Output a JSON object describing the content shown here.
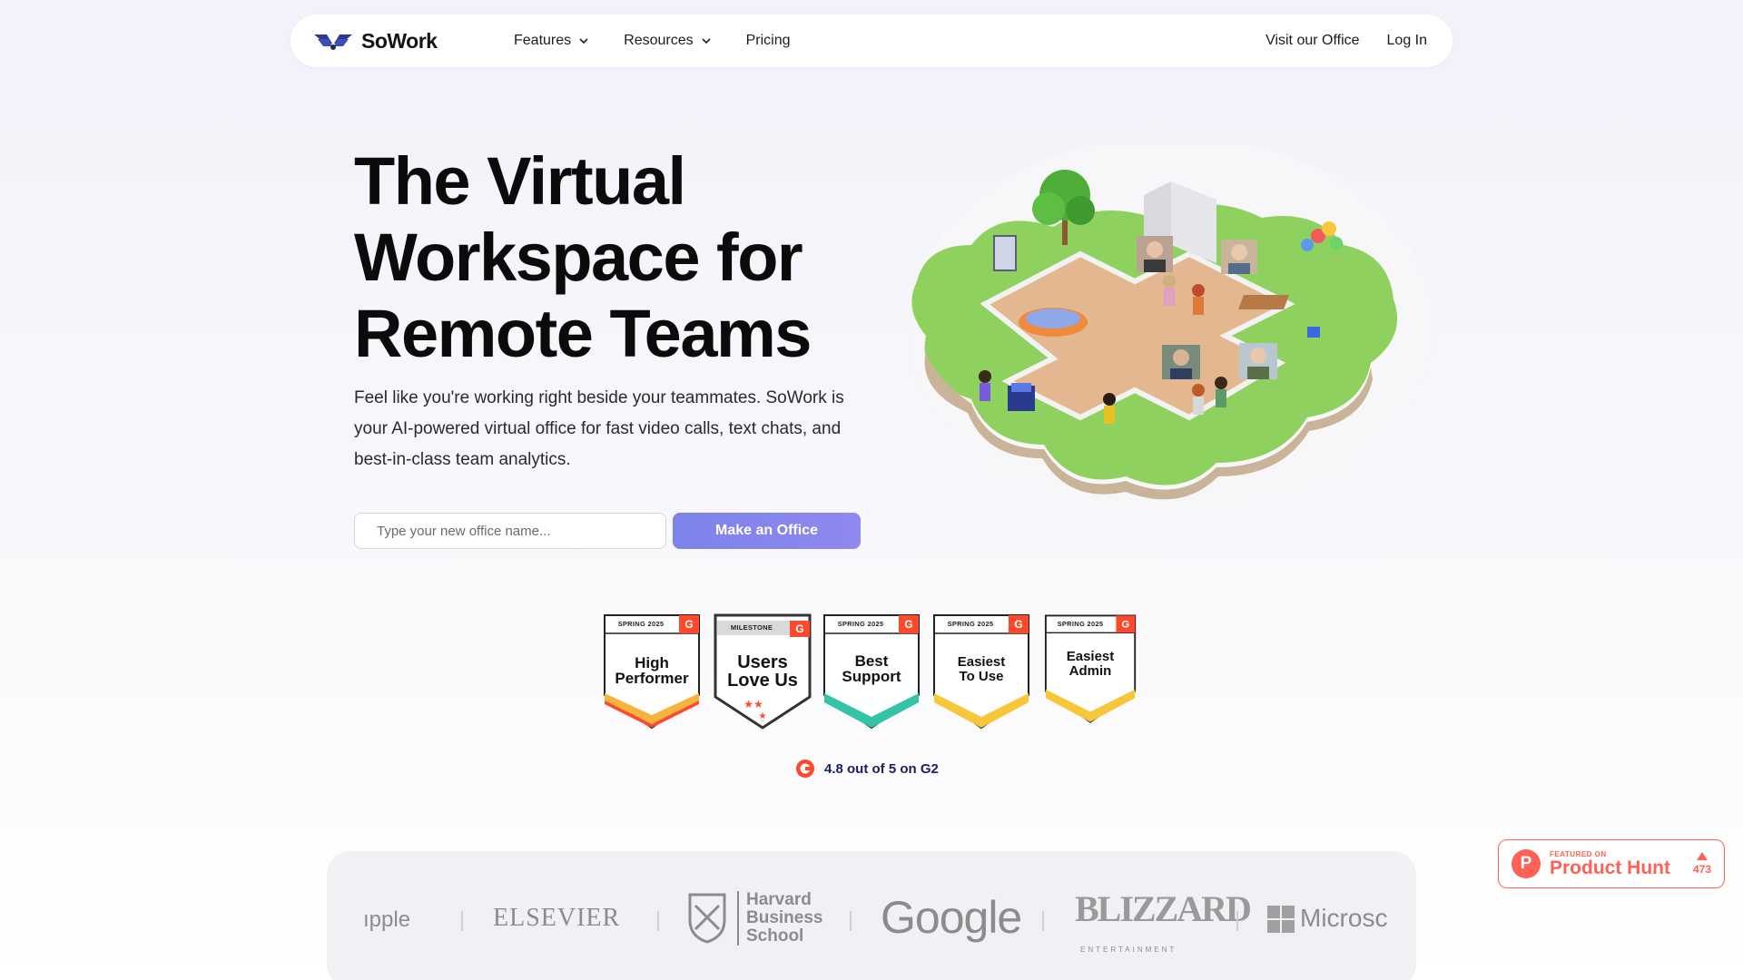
{
  "brand": {
    "name": "SoWork",
    "accent": "#7c83ea"
  },
  "nav": {
    "features": "Features",
    "resources": "Resources",
    "pricing": "Pricing",
    "visit_office": "Visit our Office",
    "login": "Log In"
  },
  "hero": {
    "title_line1": "The Virtual",
    "title_line2": "Workspace for",
    "title_line3": "Remote Teams",
    "subtitle": "Feel like you're working right beside your teammates. SoWork is your AI-powered virtual office for fast video calls, text chats, and best-in-class team analytics.",
    "input_placeholder": "Type your new office name...",
    "cta": "Make an Office"
  },
  "badges": [
    {
      "top": "SPRING 2025",
      "line1": "High",
      "line2": "Performer"
    },
    {
      "top": "MILESTONE",
      "line1": "Users",
      "line2": "Love Us"
    },
    {
      "top": "SPRING 2025",
      "line1": "Best",
      "line2": "Support"
    },
    {
      "top": "SPRING 2025",
      "line1": "Easiest",
      "line2": "To Use"
    },
    {
      "top": "SPRING 2025",
      "line1": "Easiest",
      "line2": "Admin"
    }
  ],
  "rating": {
    "text": "4.8 out of 5 on G2"
  },
  "logos": {
    "apple": "ıpple",
    "elsevier": "ELSEVIER",
    "harvard1": "Harvard",
    "harvard2": "Business",
    "harvard3": "School",
    "google": "Google",
    "blizzard": "BLIZZARD",
    "blizzard_sub": "ENTERTAINMENT",
    "microsoft": "Microsc"
  },
  "product_hunt": {
    "letter": "P",
    "featured": "FEATURED ON",
    "name": "Product Hunt",
    "votes": "473"
  }
}
